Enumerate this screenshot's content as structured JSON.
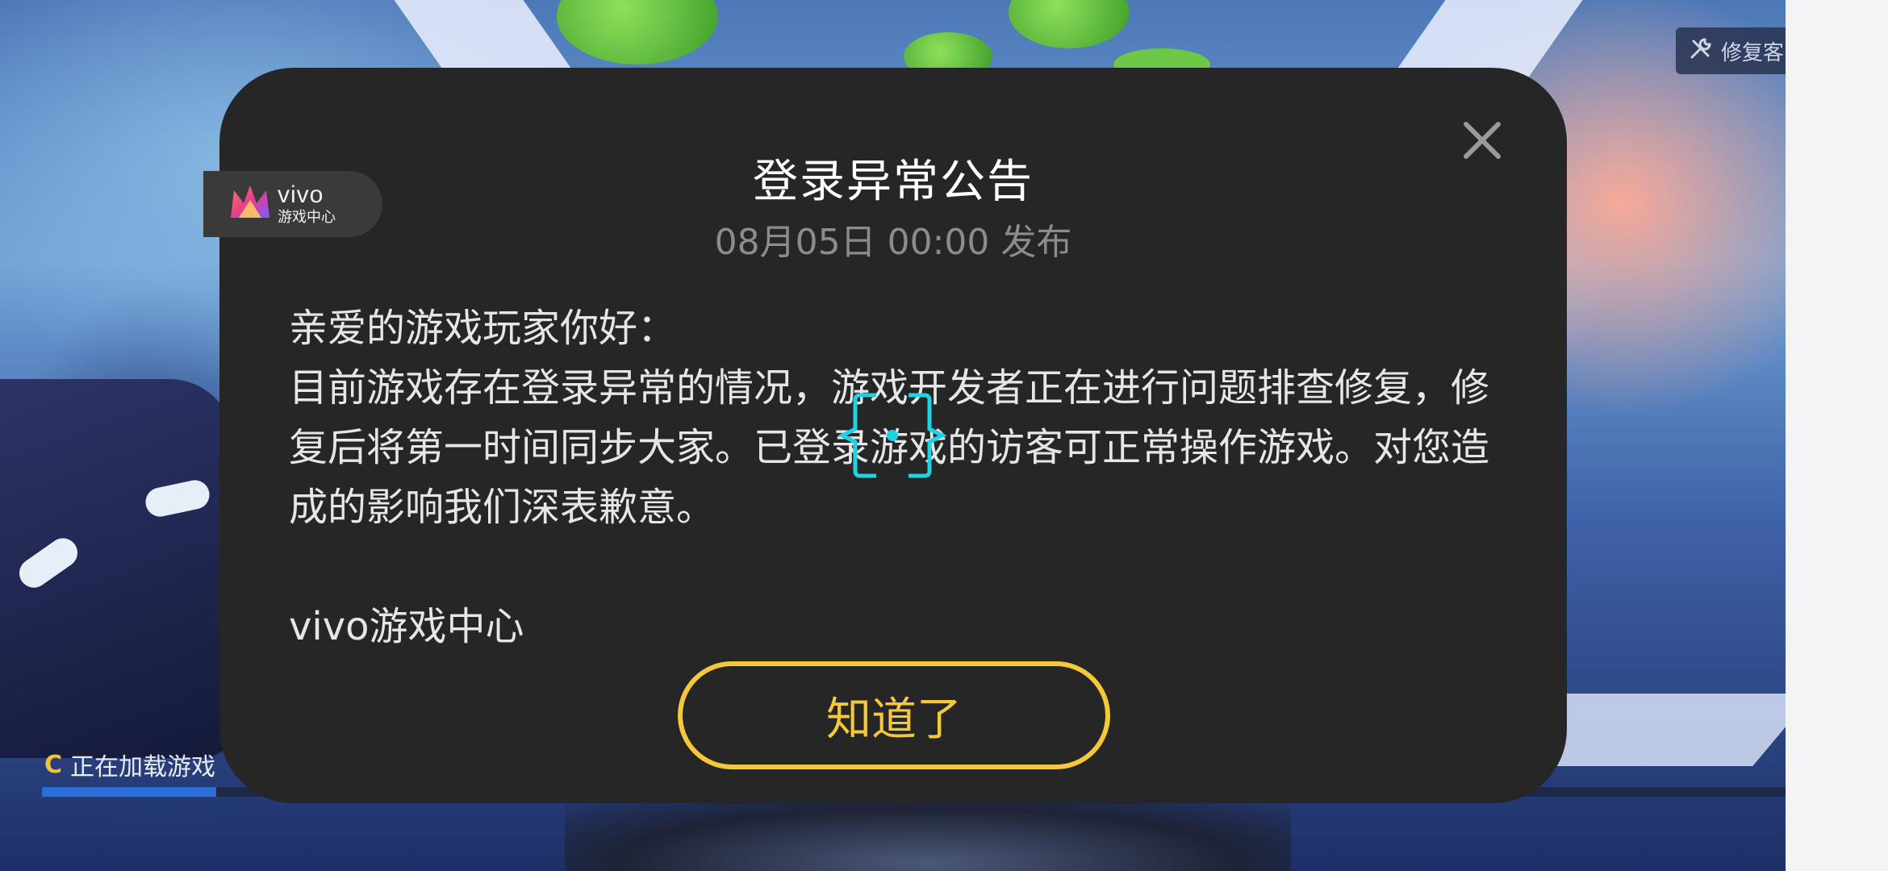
{
  "game": {
    "repair_label": "修复客",
    "loading_text": "正在加载游戏",
    "loading_progress": 0.1
  },
  "badge": {
    "brand": "vivo",
    "sub": "游戏中心"
  },
  "dialog": {
    "title": "登录异常公告",
    "published": "08月05日 00:00 发布",
    "greeting": "亲爱的游戏玩家你好：",
    "message": "目前游戏存在登录异常的情况，游戏开发者正在进行问题排查修复，修复后将第一时间同步大家。已登录游戏的访客可正常操作游戏。对您造成的影响我们深表歉意。",
    "signature": "vivo游戏中心",
    "ok_label": "知道了"
  },
  "colors": {
    "accent": "#f5c73c",
    "dialog_bg": "#262626",
    "cursor": "#1fd3e6"
  },
  "icons": {
    "close": "close-icon",
    "repair": "wrench-icon",
    "loading": "loading-spinner-icon",
    "brand": "vivo-crown-logo",
    "cursor": "tap-cursor-icon"
  }
}
